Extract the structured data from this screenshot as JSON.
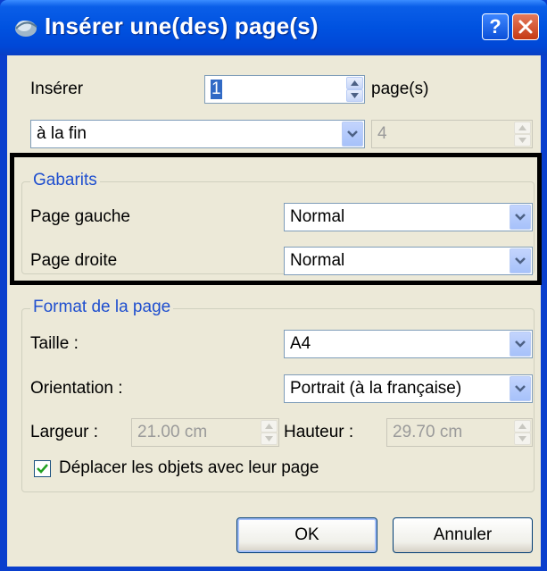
{
  "window": {
    "title": "Insérer une(des) page(s)"
  },
  "insert": {
    "label": "Insérer",
    "count_value": "1",
    "unit_label": "page(s)",
    "position_value": "à la fin",
    "page_number_value": "4"
  },
  "templates": {
    "group_title": "Gabarits",
    "left_label": "Page gauche",
    "left_value": "Normal",
    "right_label": "Page droite",
    "right_value": "Normal"
  },
  "page_format": {
    "group_title": "Format de la page",
    "size_label": "Taille :",
    "size_value": "A4",
    "orientation_label": "Orientation :",
    "orientation_value": "Portrait (à la française)",
    "width_label": "Largeur :",
    "width_value": "21.00 cm",
    "height_label": "Hauteur :",
    "height_value": "29.70 cm",
    "move_objects_label": "Déplacer les objets avec leur page",
    "move_objects_checked": true
  },
  "buttons": {
    "ok": "OK",
    "cancel": "Annuler"
  },
  "colors": {
    "titlebar": "#0052e0",
    "dialog_bg": "#ece9d8",
    "group_title": "#1f4fcf",
    "highlight_border": "#000000"
  }
}
